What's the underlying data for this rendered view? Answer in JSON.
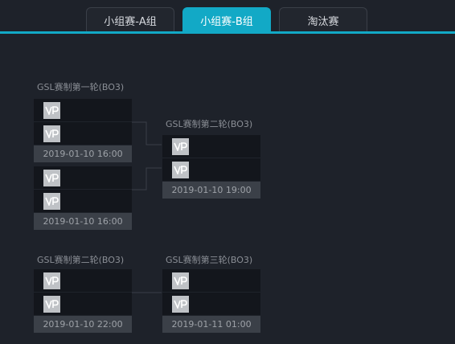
{
  "tabs": [
    {
      "label": "小组赛-A组",
      "active": false
    },
    {
      "label": "小组赛-B组",
      "active": true
    },
    {
      "label": "淘汰赛",
      "active": false
    }
  ],
  "bracket": {
    "round1_title": "GSL赛制第一轮(BO3)",
    "round2_upper_title": "GSL赛制第二轮(BO3)",
    "round2_lower_title": "GSL赛制第二轮(BO3)",
    "round3_title": "GSL赛制第三轮(BO3)",
    "matches": {
      "r1_match1": {
        "time": "2019-01-10 16:00",
        "team1_logo": "vp-logo-icon",
        "team2_logo": "vp-logo-icon"
      },
      "r1_match2": {
        "time": "2019-01-10 16:00",
        "team1_logo": "vp-logo-icon",
        "team2_logo": "vp-logo-icon"
      },
      "r2_upper": {
        "time": "2019-01-10 19:00",
        "team1_logo": "vp-logo-icon",
        "team2_logo": "vp-logo-icon"
      },
      "r2_lower": {
        "time": "2019-01-10 22:00",
        "team1_logo": "vp-logo-icon",
        "team2_logo": "vp-logo-icon"
      },
      "r3": {
        "time": "2019-01-11 01:00",
        "team1_logo": "vp-logo-icon",
        "team2_logo": "vp-logo-icon"
      }
    }
  },
  "colors": {
    "background": "#1e222a",
    "accent": "#12a9c6",
    "slot": "#13161c",
    "time_bar": "#3b4048"
  }
}
